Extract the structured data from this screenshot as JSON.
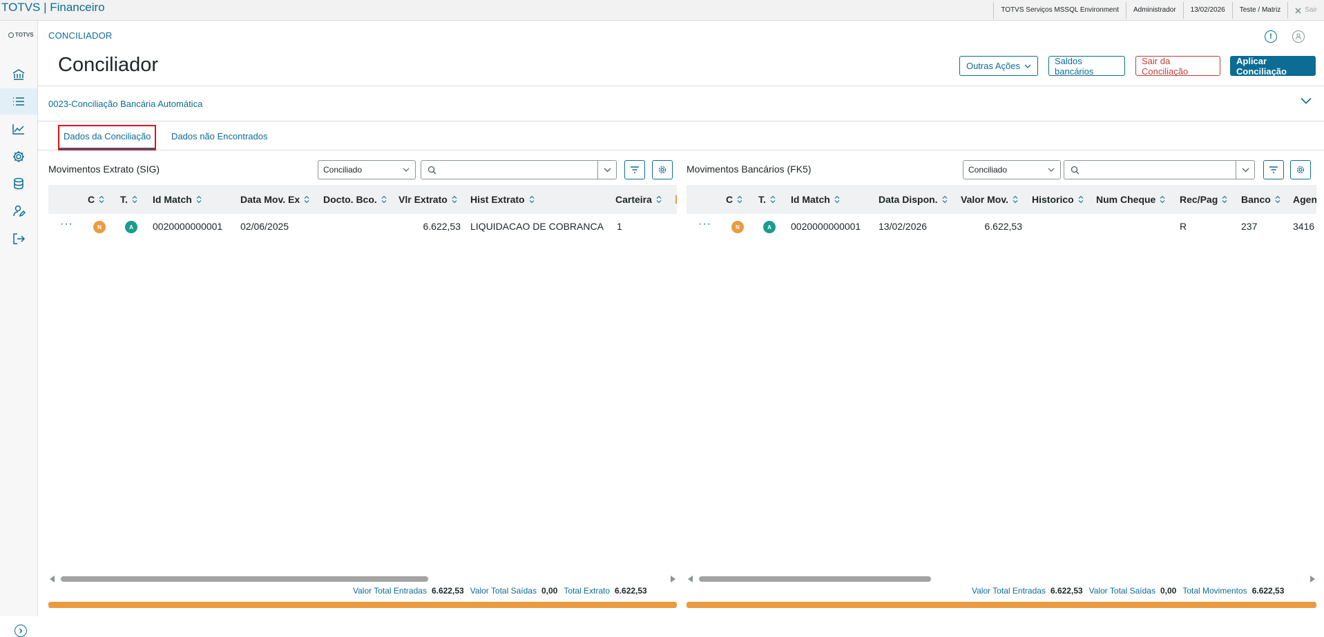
{
  "app": {
    "title": "TOTVS | Financeiro"
  },
  "topbar": {
    "environment": "TOTVS Serviços MSSQL Environment",
    "user": "Administrador",
    "date": "13/02/2026",
    "branch": "Teste / Matriz",
    "exit_label": "Sair"
  },
  "sidebar": {
    "logo": "TOTVS",
    "items": [
      {
        "icon": "bank-icon"
      },
      {
        "icon": "list-icon",
        "active": true
      },
      {
        "icon": "chart-line-icon"
      },
      {
        "icon": "gear-icon"
      },
      {
        "icon": "database-icon"
      },
      {
        "icon": "user-edit-icon"
      },
      {
        "icon": "exit-icon"
      }
    ]
  },
  "header": {
    "breadcrumb": "CONCILIADOR",
    "title": "Conciliador",
    "buttons": {
      "other_actions": "Outras Ações",
      "bank_balances": "Saldos bancários",
      "exit_reconciliation": "Sair da Conciliação",
      "apply_reconciliation": "Aplicar Conciliação"
    }
  },
  "accordion": {
    "label": "0023-Conciliação Bancária Automática"
  },
  "tabs": [
    {
      "label": "Dados da Conciliação",
      "active": true
    },
    {
      "label": "Dados não Encontrados",
      "active": false
    }
  ],
  "left_panel": {
    "title": "Movimentos Extrato (SIG)",
    "filter_value": "Conciliado",
    "search_placeholder": "",
    "columns": [
      "C",
      "T.",
      "Id Match",
      "Data Mov. Ex",
      "Docto. Bco.",
      "Vlr Extrato",
      "Hist Extrato",
      "Carteira"
    ],
    "rows": [
      {
        "c": "N",
        "t": "A",
        "id_match": "0020000000001",
        "data_mov": "02/06/2025",
        "docto": "",
        "valor": "6.622,53",
        "historico": "LIQUIDACAO DE COBRANCA",
        "carteira": "1"
      }
    ],
    "totals": {
      "entradas_label": "Valor Total Entradas",
      "entradas_value": "6.622,53",
      "saidas_label": "Valor Total Saídas",
      "saidas_value": "0,00",
      "total_label": "Total Extrato",
      "total_value": "6.622,53"
    }
  },
  "right_panel": {
    "title": "Movimentos Bancários (FK5)",
    "filter_value": "Conciliado",
    "search_placeholder": "",
    "columns": [
      "C",
      "T.",
      "Id Match",
      "Data Dispon.",
      "Valor Mov.",
      "Historico",
      "Num Cheque",
      "Rec/Pag",
      "Banco",
      "Agen"
    ],
    "rows": [
      {
        "c": "N",
        "t": "A",
        "id_match": "0020000000001",
        "data_dispon": "13/02/2026",
        "valor": "6.622,53",
        "historico": "",
        "num_cheque": "",
        "rec_pag": "R",
        "banco": "237",
        "agencia": "3416"
      }
    ],
    "totals": {
      "entradas_label": "Valor Total Entradas",
      "entradas_value": "6.622,53",
      "saidas_label": "Valor Total Saídas",
      "saidas_value": "0,00",
      "total_label": "Total Movimentos",
      "total_value": "6.622,53"
    }
  }
}
